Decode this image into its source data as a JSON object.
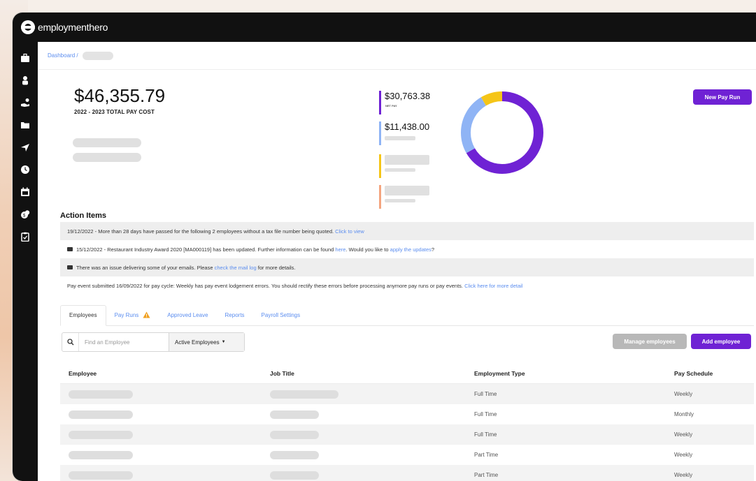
{
  "app": {
    "name": "employmenthero"
  },
  "sidebar": {
    "items": [
      {
        "icon": "briefcase-icon"
      },
      {
        "icon": "person-icon"
      },
      {
        "icon": "hand-money-icon"
      },
      {
        "icon": "folder-icon"
      },
      {
        "icon": "plane-icon"
      },
      {
        "icon": "clock-icon"
      },
      {
        "icon": "calendar-icon"
      },
      {
        "icon": "coins-icon"
      },
      {
        "icon": "clipboard-icon"
      }
    ]
  },
  "breadcrumb": {
    "root": "Dashboard /"
  },
  "summary": {
    "total": "$46,355.79",
    "total_label": "2022 - 2023 TOTAL PAY COST"
  },
  "stats": {
    "net_pay": {
      "value": "$30,763.38",
      "label": "NET PAY",
      "color": "#6f22d4"
    },
    "second": {
      "value": "$11,438.00",
      "color": "#8fb4f5"
    },
    "third_color": "#f5c518",
    "fourth_color": "#f4a57f"
  },
  "donut": {
    "colors": {
      "purple": "#6f22d4",
      "blue": "#8fb4f5",
      "yellow": "#f5c518"
    }
  },
  "new_pay_run_label": "New Pay Run",
  "action_items": {
    "title": "Action Items",
    "rows": [
      {
        "text": "19/12/2022 - More than 28 days have passed for the following 2 employees without a tax file number being quoted. ",
        "link": "Click to view"
      },
      {
        "pre": "15/12/2022 - Restaurant Industry Award 2020 [MA000119] has been updated. Further information can be found ",
        "link1": "here",
        "mid": ". Would you like to ",
        "link2": "apply the updates",
        "post": "?"
      },
      {
        "pre": "There was an issue delivering some of your emails. Please ",
        "link": "check the mail log",
        "post": " for more details."
      },
      {
        "text": "Pay event submitted 16/09/2022 for pay cycle: Weekly has pay event lodgement errors. You should rectify these errors before processing anymore pay runs or pay events. ",
        "link": "Click here for more detail"
      }
    ]
  },
  "tabs": {
    "employees": "Employees",
    "pay_runs": "Pay Runs",
    "approved_leave": "Approved Leave",
    "reports": "Reports",
    "payroll_settings": "Payroll Settings"
  },
  "search": {
    "placeholder": "Find an Employee",
    "filter": "Active Employees"
  },
  "buttons": {
    "manage": "Manage employees",
    "add": "Add employee"
  },
  "table": {
    "headers": {
      "employee": "Employee",
      "job_title": "Job Title",
      "employment_type": "Employment Type",
      "pay_schedule": "Pay Schedule"
    },
    "rows": [
      {
        "employment_type": "Full Time",
        "pay_schedule": "Weekly"
      },
      {
        "employment_type": "Full Time",
        "pay_schedule": "Monthly"
      },
      {
        "employment_type": "Full Time",
        "pay_schedule": "Weekly"
      },
      {
        "employment_type": "Part Time",
        "pay_schedule": "Weekly"
      },
      {
        "employment_type": "Part Time",
        "pay_schedule": "Weekly"
      }
    ]
  }
}
